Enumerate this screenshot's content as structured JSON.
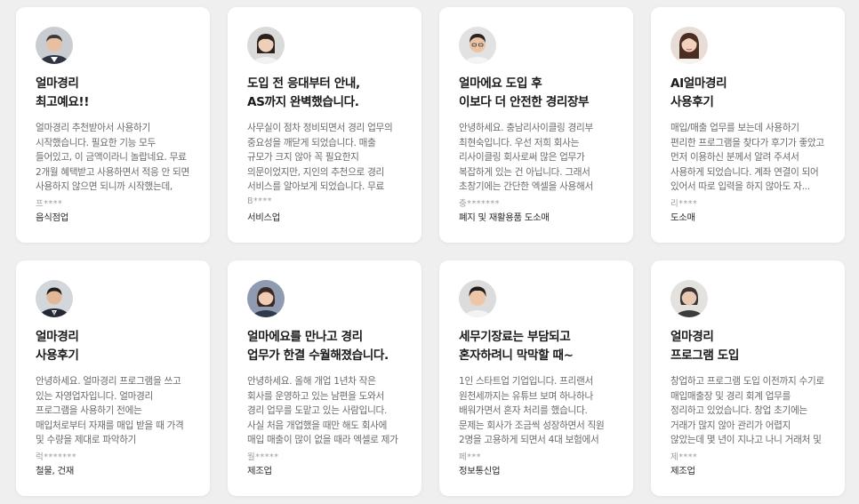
{
  "reviews": [
    {
      "avatar_icon": "man-suit-smiling-avatar",
      "title": "얼마경리\n최고예요!!",
      "body": "얼마경리 추천받아서 사용하기 시작했습니다. 필요한 기능 모두 들어있고, 이 금액이라니 놀랍네요. 무료 2개월 혜택받고 사용하면서 적응 안 되면 사용하지 않으면 되니까 시작했는데, 필요...",
      "author": "프****",
      "industry": "음식점업"
    },
    {
      "avatar_icon": "woman-smiling-avatar",
      "title": "도입 전 응대부터 안내,\nAS까지 완벽했습니다.",
      "body": "사무실이 점차 정비되면서 경리 업무의 중요성을 깨닫게 되었습니다. 매출 규모가 크지 않아 꼭 필요한지 의문이었지만, 지인의 추천으로 경리 서비스를 알아보게 되었습니다. 무료 서비스를...",
      "author": "B****",
      "industry": "서비스업"
    },
    {
      "avatar_icon": "young-man-avatar",
      "title": "얼마에요 도입 후\n이보다 더 안전한 경리장부",
      "body": "안녕하세요. 충남리사이클링 경리부 최현숙입니다. 우선 저희 회사는 리사이클링 회사로써 많은 업무가 복잡하게 있는 건 아닙니다. 그래서 초창기에는 간단한 엑셀을 사용해서 장부를 저장...",
      "author": "충*******",
      "industry": "폐지 및 재활용품 도소매"
    },
    {
      "avatar_icon": "woman-long-hair-avatar",
      "title": "AI얼마경리\n사용후기",
      "body": "매입/매출 업무를 보는데 사용하기 편리한 프로그램을 찾다가 후기가 좋았고 먼저 이용하신 분께서 알려 주셔서 사용하게 되었습니다. 계좌 연결이 되어 있어서 따로 입력을 하지 않아도 자...",
      "author": "리****",
      "industry": "도소매"
    },
    {
      "avatar_icon": "man-suit-avatar",
      "title": "얼마경리\n사용후기",
      "body": "안녕하세요. 얼마경리 프로그램을 쓰고 있는 자영업자입니다. 얼마경리 프로그램을 사용하기 전에는 매입처로부터 자재를 매입 받을 때 가격 및 수량을 제대로 파악하기 어려웠습니다. 그렇게 ...",
      "author": "럭*******",
      "industry": "철물, 건재"
    },
    {
      "avatar_icon": "woman-short-hair-avatar",
      "title": "얼마에요를 만나고 경리\n업무가 한결 수월해졌습니다.",
      "body": "안녕하세요. 올해 개업 1년차 작은 회사를 운영하고 있는 남편을 도와서 경리 업무를 도맡고 있는 사람입니다. 사실 처음 개업했을 때만 해도 회사에 매입 매출이 많이 없을 때라 엑셀로 제가 ...",
      "author": "월*****",
      "industry": "제조업"
    },
    {
      "avatar_icon": "man-casual-avatar",
      "title": "세무기장료는 부담되고\n혼자하려니 막막할 때~",
      "body": "1인 스타트업 기업입니다. 프리랜서 원천세까지는 유튜브 보며 하나하나 배워가면서 혼자 처리를 했습니다. 문제는 회사가 조금씩 성장하면서 직원 2명을 고용하게 되면서 4대 보험에서 막히...",
      "author": "페***",
      "industry": "정보통신업"
    },
    {
      "avatar_icon": "older-woman-avatar",
      "title": "얼마경리\n프로그램 도입",
      "body": "창업하고 프로그램 도입 이전까지 수기로 매입매출장 및 경리 회계 업무를 정리하고 있었습니다. 창업 초기에는 거래가 많지 않아 관리가 어렵지 않았는데 몇 년이 지나고 나니 거래처 및 품...",
      "author": "제****",
      "industry": "제조업"
    }
  ]
}
